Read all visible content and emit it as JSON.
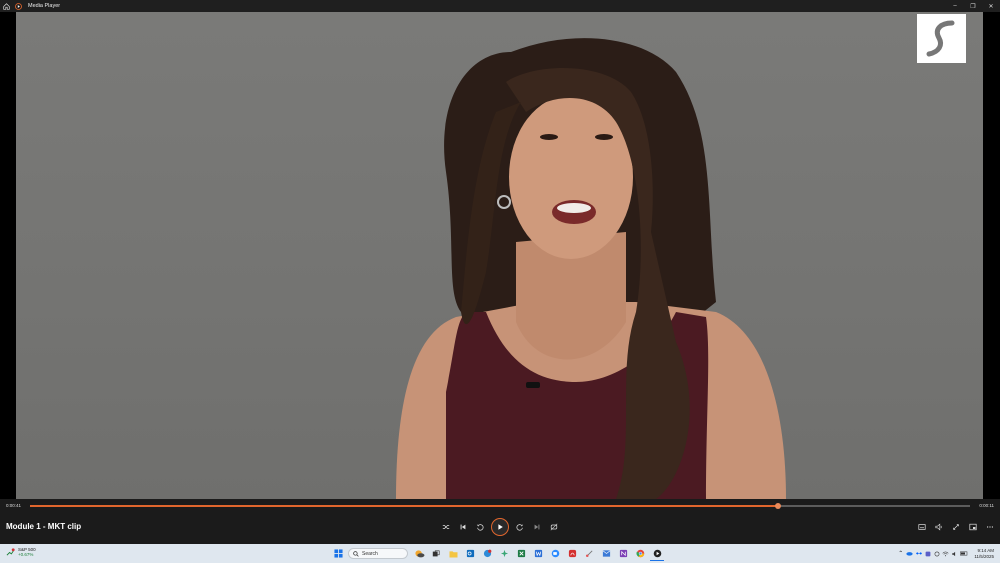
{
  "app": {
    "title": "Media Player",
    "window_controls": [
      "minimize",
      "restore",
      "close"
    ]
  },
  "player": {
    "clip_title": "Module 1 - MKT clip",
    "elapsed": "0:00:41",
    "remaining": "0:00:11",
    "progress": 0.796,
    "controls_center": [
      "shuffle-icon",
      "previous-icon",
      "rewind-10-icon",
      "play-icon",
      "forward-30-icon",
      "next-icon",
      "repeat-off-icon"
    ],
    "controls_right": [
      "captions-icon",
      "volume-icon",
      "fullscreen-icon",
      "miniplayer-icon",
      "more-icon"
    ]
  },
  "taskbar": {
    "stock_name": "S&P 500",
    "stock_change": "+0.67%",
    "search_placeholder": "Search",
    "clock_time": "9:14 AM",
    "clock_date": "11/5/2025"
  },
  "colors": {
    "accent": "#e1662d",
    "bar": "#1b1b1b",
    "taskbar": "#dfe7ef"
  }
}
